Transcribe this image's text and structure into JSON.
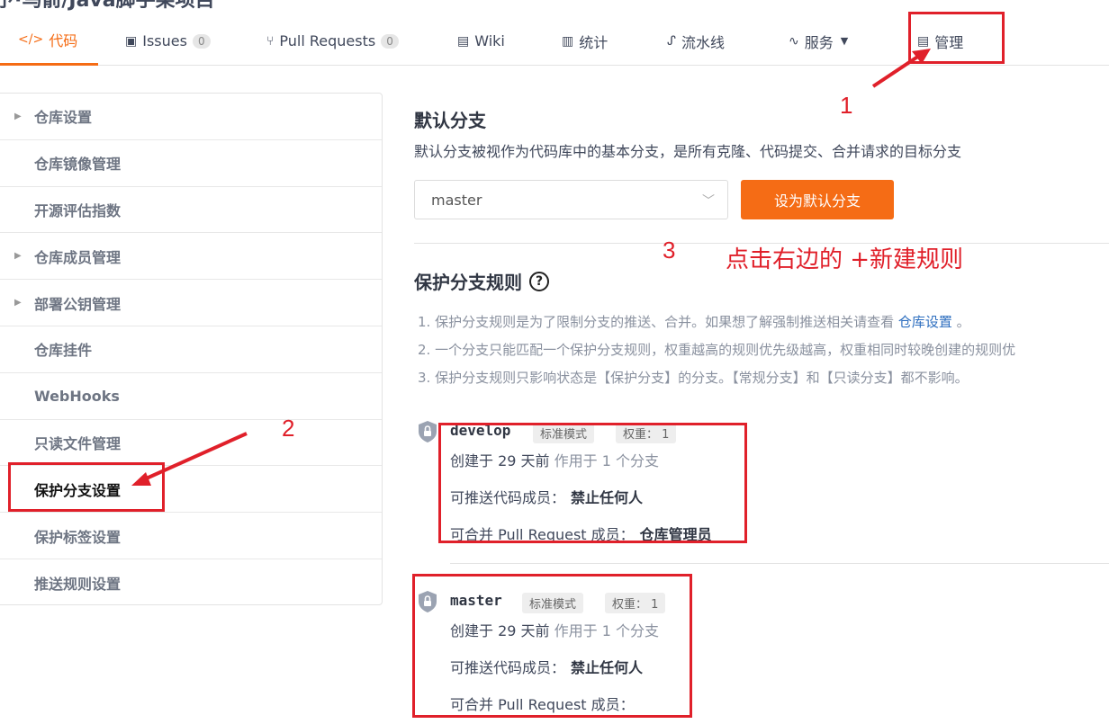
{
  "page": {
    "title": "予·乌箭/Java脚手架项目"
  },
  "nav": {
    "tabs": [
      {
        "label": "代码",
        "icon": "code-icon"
      },
      {
        "label": "Issues",
        "icon": "issues-icon",
        "count": "0"
      },
      {
        "label": "Pull Requests",
        "icon": "pull-request-icon",
        "count": "0"
      },
      {
        "label": "Wiki",
        "icon": "wiki-icon"
      },
      {
        "label": "统计",
        "icon": "chart-icon"
      },
      {
        "label": "流水线",
        "icon": "pipeline-icon"
      },
      {
        "label": "服务",
        "icon": "pulse-icon"
      },
      {
        "label": "管理",
        "icon": "manage-icon"
      }
    ]
  },
  "sidebar": {
    "items": [
      {
        "label": "仓库设置"
      },
      {
        "label": "仓库镜像管理"
      },
      {
        "label": "开源评估指数"
      },
      {
        "label": "仓库成员管理"
      },
      {
        "label": "部署公钥管理"
      },
      {
        "label": "仓库挂件"
      },
      {
        "label": "WebHooks"
      },
      {
        "label": "只读文件管理"
      },
      {
        "label": "保护分支设置"
      },
      {
        "label": "保护标签设置"
      },
      {
        "label": "推送规则设置"
      }
    ]
  },
  "default_branch": {
    "heading": "默认分支",
    "description": "默认分支被视作为代码库中的基本分支，是所有克隆、代码提交、合并请求的目标分支",
    "selected": "master",
    "button": "设为默认分支"
  },
  "protect": {
    "heading": "保护分支规则",
    "rule1_text": "1. 保护分支规则是为了限制分支的推送、合并。如果想了解强制推送相关请查看 ",
    "rule1_link": "仓库设置",
    "rule1_tail": " 。",
    "rule2": "2. 一个分支只能匹配一个保护分支规则，权重越高的规则优先级越高，权重相同时较晚创建的规则优",
    "rule3": "3. 保护分支规则只影响状态是【保护分支】的分支。【常规分支】和【只读分支】都不影响。",
    "cards": [
      {
        "branch": "develop",
        "mode": "标准模式",
        "weight": "权重： 1",
        "created": "创建于 29 天前",
        "applies": "作用于 1 个分支",
        "push_label": "可推送代码成员：",
        "push_value": "禁止任何人",
        "merge_label": "可合并 Pull Request 成员：",
        "merge_value": "仓库管理员"
      },
      {
        "branch": "master",
        "mode": "标准模式",
        "weight": "权重： 1",
        "created": "创建于 29 天前",
        "applies": "作用于 1 个分支",
        "push_label": "可推送代码成员：",
        "push_value": "禁止任何人",
        "merge_label": "可合并 Pull Request 成员：",
        "merge_value": ""
      }
    ]
  },
  "annotations": {
    "n1": "1",
    "n2": "2",
    "n3": "3",
    "hint": "点击右边的 +新建规则",
    "color": "#e0202a"
  },
  "colors": {
    "accent": "#f56c15",
    "link": "#2d6ebf"
  }
}
